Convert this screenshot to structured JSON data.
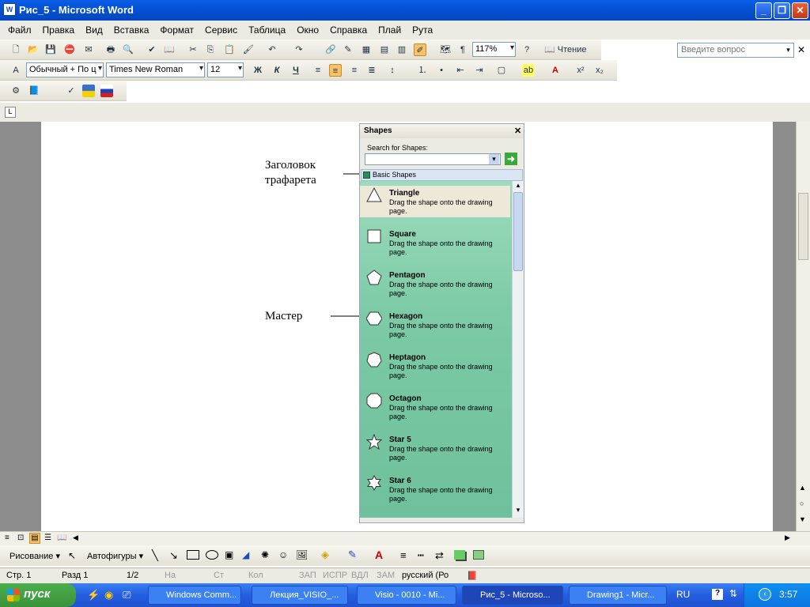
{
  "window": {
    "title": "Рис_5 - Microsoft Word",
    "app_icon": "W"
  },
  "menu": [
    "Файл",
    "Правка",
    "Вид",
    "Вставка",
    "Формат",
    "Сервис",
    "Таблица",
    "Окно",
    "Справка",
    "Плай",
    "Рута"
  ],
  "ask_placeholder": "Введите вопрос",
  "toolbar": {
    "zoom": "117%",
    "reading_label": "Чтение",
    "style": "Обычный + По ц",
    "font": "Times New Roman",
    "size": "12",
    "bold": "Ж",
    "italic": "К",
    "underline": "Ч"
  },
  "annotations": {
    "header_line1": "Заголовок",
    "header_line2": "трафарета",
    "master": "Мастер"
  },
  "shapes_pane": {
    "title": "Shapes",
    "search_label": "Search for Shapes:",
    "stencil": "Basic Shapes",
    "items": [
      {
        "name": "Triangle",
        "desc": "Drag the shape onto the drawing page.",
        "icon": "triangle-icon"
      },
      {
        "name": "Square",
        "desc": "Drag the shape onto the drawing page.",
        "icon": "square-icon"
      },
      {
        "name": "Pentagon",
        "desc": "Drag the shape onto the drawing page.",
        "icon": "pentagon-icon"
      },
      {
        "name": "Hexagon",
        "desc": "Drag the shape onto the drawing page.",
        "icon": "hexagon-icon"
      },
      {
        "name": "Heptagon",
        "desc": "Drag the shape onto the drawing page.",
        "icon": "heptagon-icon"
      },
      {
        "name": "Octagon",
        "desc": "Drag the shape onto the drawing page.",
        "icon": "octagon-icon"
      },
      {
        "name": "Star 5",
        "desc": "Drag the shape onto the drawing page.",
        "icon": "star5-icon"
      },
      {
        "name": "Star 6",
        "desc": "Drag the shape onto the drawing page.",
        "icon": "star6-icon"
      }
    ]
  },
  "drawing_toolbar": {
    "draw_label": "Рисование",
    "autoshapes_label": "Автофигуры"
  },
  "status": {
    "page": "Стр. 1",
    "section": "Разд 1",
    "pages": "1/2",
    "at": "На",
    "line": "Ст",
    "col": "Кол",
    "rec": "ЗАП",
    "trk": "ИСПР",
    "ext": "ВДЛ",
    "ovr": "ЗАМ",
    "lang": "русский (Ро"
  },
  "taskbar": {
    "start": "пуск",
    "tasks": [
      "Windows Comm...",
      "Лекция_VISIO_...",
      "Visio - 0010 - Mi...",
      "Рис_5 - Microso...",
      "Drawing1 - Micr..."
    ],
    "lang": "RU",
    "time": "3:57"
  },
  "colors": {
    "title_bar": "#0553d4",
    "shapes_list": "#7ccaa6",
    "taskbar": "#245ee0",
    "start": "#3a933a"
  }
}
